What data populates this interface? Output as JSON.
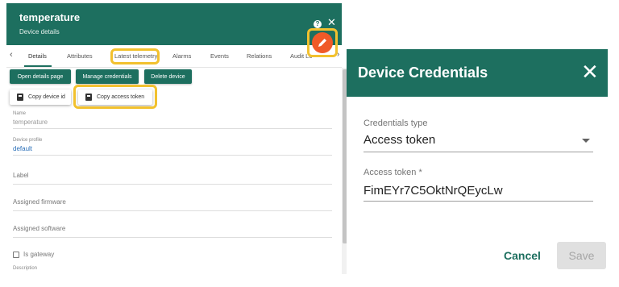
{
  "device": {
    "title": "temperature",
    "subtitle": "Device details",
    "help_symbol": "?",
    "close_symbol": "✕"
  },
  "tabs": [
    {
      "label": "Details"
    },
    {
      "label": "Attributes"
    },
    {
      "label": "Latest telemetry"
    },
    {
      "label": "Alarms"
    },
    {
      "label": "Events"
    },
    {
      "label": "Relations"
    },
    {
      "label": "Audit Lo"
    }
  ],
  "tab_nav": {
    "prev_symbol": "‹",
    "next_symbol": "›"
  },
  "actions": {
    "open_details": "Open details page",
    "manage_credentials": "Manage credentials",
    "delete_device": "Delete device",
    "copy_device_id": "Copy device id",
    "copy_access_token": "Copy access token"
  },
  "fields": {
    "name_label": "Name",
    "name_value": "temperature",
    "profile_label": "Device profile",
    "profile_value": "default",
    "label_field": "Label",
    "assigned_firmware": "Assigned firmware",
    "assigned_software": "Assigned software",
    "is_gateway": "Is gateway",
    "description": "Description"
  },
  "credentials": {
    "title": "Device Credentials",
    "close_symbol": "✕",
    "type_label": "Credentials type",
    "type_value": "Access token",
    "token_label": "Access token *",
    "token_value": "FimEYr7C5OktNrQEycLw",
    "cancel": "Cancel",
    "save": "Save"
  },
  "colors": {
    "primary": "#1d6f5f",
    "accent": "#f05a28",
    "highlight": "#f2c12e"
  }
}
